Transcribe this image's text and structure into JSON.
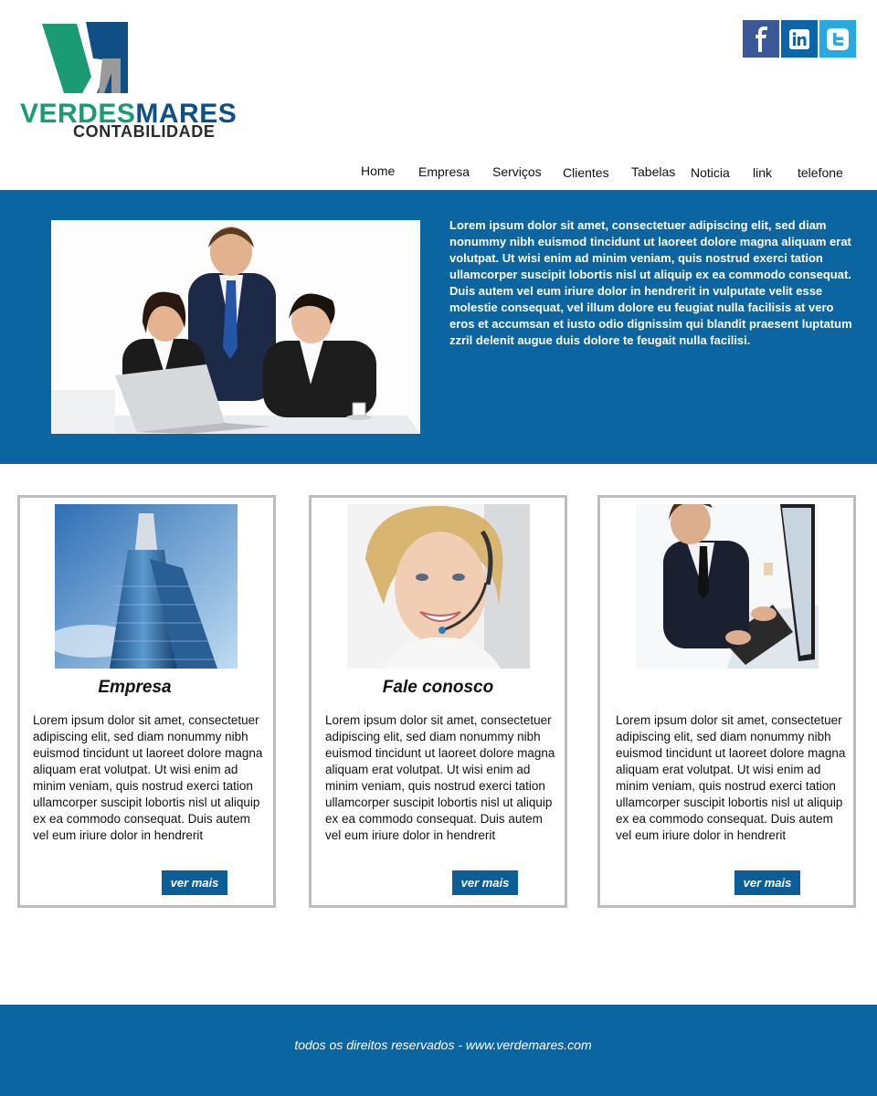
{
  "brand": {
    "name_part1": "VERDES",
    "name_part2": "MARES",
    "tagline": "CONTABILIDADE",
    "logo_colors": {
      "green": "#1a9b74",
      "blue": "#0f4f86",
      "grey": "#9a9a9a"
    }
  },
  "social": [
    {
      "icon": "facebook-icon",
      "label": "f",
      "color": "#3b5998"
    },
    {
      "icon": "linkedin-icon",
      "label": "in",
      "color": "#0a66a8"
    },
    {
      "icon": "twitter-icon",
      "label": "t",
      "color": "#29a9e1"
    }
  ],
  "nav": [
    "Home",
    "Empresa",
    "Serviços",
    "Clientes",
    "Tabelas",
    "Noticia",
    "link",
    "telefone"
  ],
  "hero": {
    "text": "Lorem ipsum dolor sit amet, consectetuer adipiscing elit, sed diam nonummy nibh euismod tincidunt ut laoreet dolore magna aliquam erat volutpat. Ut wisi enim ad minim veniam, quis nostrud exerci tation ullamcorper suscipit lobortis nisl ut aliquip ex ea commodo consequat. Duis autem vel eum iriure dolor in hendrerit in vulputate velit esse molestie consequat, vel illum dolore eu feugiat nulla facilisis at vero eros et accumsan et iusto odio dignissim qui blandit praesent luptatum zzril delenit augue duis dolore te feugait nulla facilisi."
  },
  "cards": [
    {
      "title": "Empresa",
      "body": "Lorem ipsum dolor sit amet, consectetuer adipiscing elit, sed diam nonummy nibh euismod tincidunt ut laoreet dolore magna aliquam erat volutpat. Ut wisi enim ad minim veniam, quis nostrud exerci tation ullamcorper suscipit lobortis nisl ut aliquip ex ea commodo consequat. Duis autem vel eum iriure dolor in hendrerit",
      "button": "ver mais"
    },
    {
      "title": "Fale conosco",
      "body": "Lorem ipsum dolor sit amet, consectetuer adipiscing elit, sed diam nonummy nibh euismod tincidunt ut laoreet dolore magna aliquam erat volutpat. Ut wisi enim ad minim veniam, quis nostrud exerci tation ullamcorper suscipit lobortis nisl ut aliquip ex ea commodo consequat. Duis autem vel eum iriure dolor in hendrerit",
      "button": "ver mais"
    },
    {
      "title": "",
      "body": "Lorem ipsum dolor sit amet, consectetuer adipiscing elit, sed diam nonummy nibh euismod tincidunt ut laoreet dolore magna aliquam erat volutpat. Ut wisi enim ad minim veniam, quis nostrud exerci tation ullamcorper suscipit lobortis nisl ut aliquip ex ea commodo consequat. Duis autem vel eum iriure dolor in hendrerit",
      "button": "ver mais"
    }
  ],
  "footer": {
    "text": "todos os direitos reservados - www.verdemares.com"
  },
  "colors": {
    "primary": "#0b65a0",
    "button": "#0b5e98",
    "card_border": "#bdbdbd"
  }
}
